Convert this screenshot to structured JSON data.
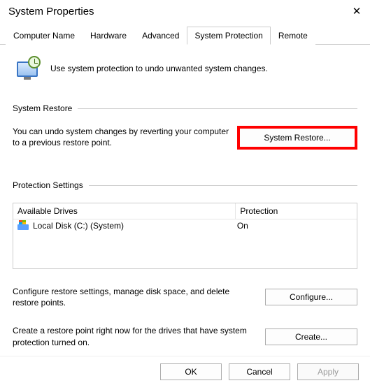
{
  "window": {
    "title": "System Properties"
  },
  "tabs": [
    {
      "label": "Computer Name"
    },
    {
      "label": "Hardware"
    },
    {
      "label": "Advanced"
    },
    {
      "label": "System Protection"
    },
    {
      "label": "Remote"
    }
  ],
  "active_tab": "System Protection",
  "intro": "Use system protection to undo unwanted system changes.",
  "restore": {
    "heading": "System Restore",
    "text": "You can undo system changes by reverting your computer to a previous restore point.",
    "button": "System Restore..."
  },
  "protection": {
    "heading": "Protection Settings",
    "columns": {
      "drive": "Available Drives",
      "protection": "Protection"
    },
    "drives": [
      {
        "name": "Local Disk (C:) (System)",
        "protection": "On"
      }
    ],
    "configure": {
      "text": "Configure restore settings, manage disk space, and delete restore points.",
      "button": "Configure..."
    },
    "create": {
      "text": "Create a restore point right now for the drives that have system protection turned on.",
      "button": "Create..."
    }
  },
  "footer": {
    "ok": "OK",
    "cancel": "Cancel",
    "apply": "Apply"
  }
}
